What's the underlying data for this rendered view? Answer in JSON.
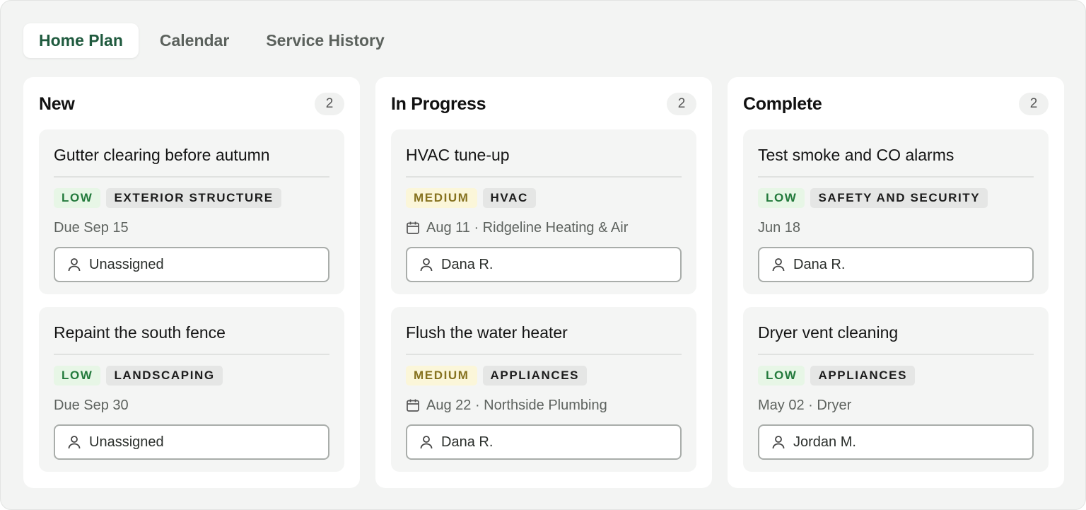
{
  "tabs": [
    {
      "label": "Home Plan",
      "active": true
    },
    {
      "label": "Calendar",
      "active": false
    },
    {
      "label": "Service History",
      "active": false
    }
  ],
  "columns": [
    {
      "title": "New",
      "count": "2",
      "cards": [
        {
          "title": "Gutter clearing before autumn",
          "priority": "LOW",
          "category": "EXTERIOR STRUCTURE",
          "meta": "Due Sep 15",
          "meta_icon": "none",
          "assignee": "Unassigned"
        },
        {
          "title": "Repaint the south fence",
          "priority": "LOW",
          "category": "LANDSCAPING",
          "meta": "Due Sep 30",
          "meta_icon": "none",
          "assignee": "Unassigned"
        }
      ]
    },
    {
      "title": "In Progress",
      "count": "2",
      "cards": [
        {
          "title": "HVAC tune-up",
          "priority": "MEDIUM",
          "category": "HVAC",
          "meta": "Aug 11 · Ridgeline Heating & Air",
          "meta_icon": "calendar-icon",
          "assignee": "Dana R."
        },
        {
          "title": "Flush the water heater",
          "priority": "MEDIUM",
          "category": "APPLIANCES",
          "meta": "Aug 22 · Northside Plumbing",
          "meta_icon": "calendar-icon",
          "assignee": "Dana R."
        }
      ]
    },
    {
      "title": "Complete",
      "count": "2",
      "cards": [
        {
          "title": "Test smoke and CO alarms",
          "priority": "LOW",
          "category": "SAFETY AND SECURITY",
          "meta": "Jun 18",
          "meta_icon": "none",
          "assignee": "Dana R."
        },
        {
          "title": "Dryer vent cleaning",
          "priority": "LOW",
          "category": "APPLIANCES",
          "meta": "May 02 · Dryer",
          "meta_icon": "none",
          "assignee": "Jordan M."
        }
      ]
    }
  ],
  "colors": {
    "accent": "#1f5a3e",
    "low_bg": "#e7f6e6",
    "low_text": "#237a3c",
    "medium_bg": "#fbf6d9",
    "medium_text": "#86721f"
  }
}
